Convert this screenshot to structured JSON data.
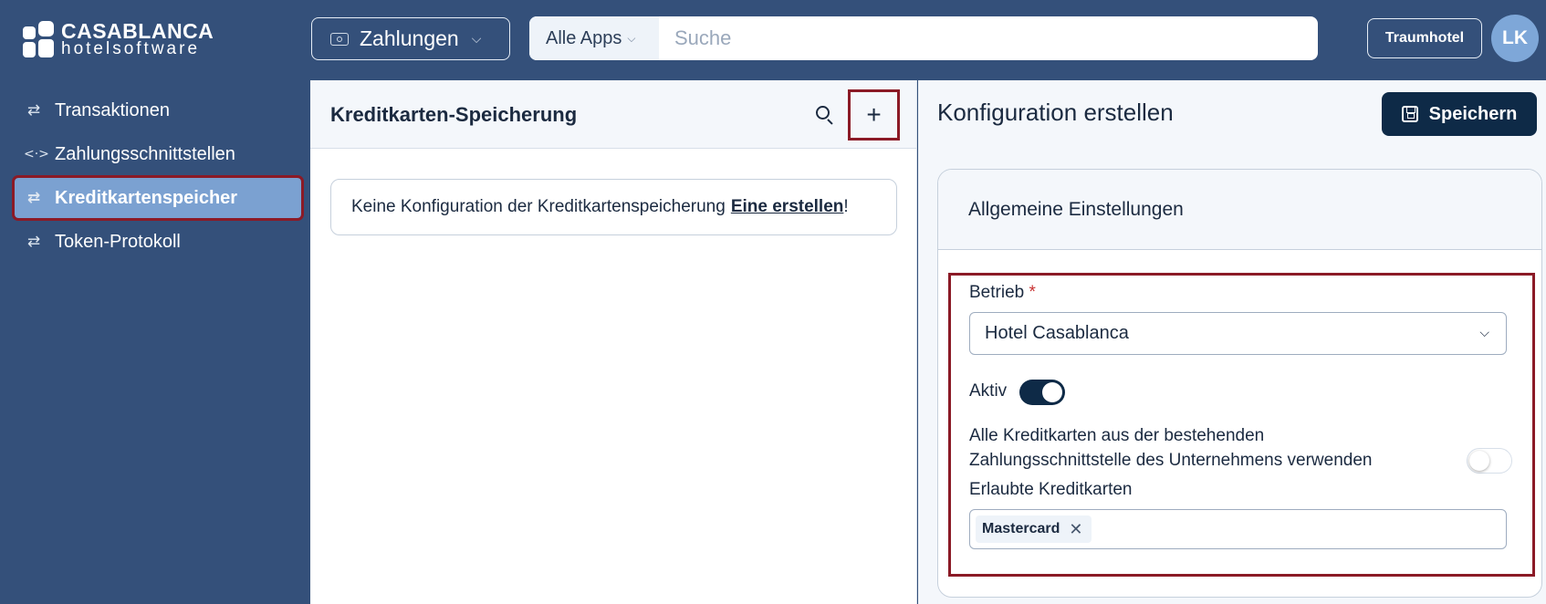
{
  "brand": {
    "line1": "CASABLANCA",
    "line2": "hotelsoftware"
  },
  "header": {
    "app_switcher_label": "Zahlungen",
    "app_switcher_icon": "wallet-icon",
    "search_scope": "Alle Apps",
    "search_placeholder": "Suche",
    "hotel_button": "Traumhotel",
    "avatar_initials": "LK"
  },
  "sidebar": {
    "items": [
      {
        "label": "Transaktionen",
        "icon": "arrows-swap-icon",
        "active": false
      },
      {
        "label": "Zahlungsschnittstellen",
        "icon": "code-brackets-icon",
        "active": false
      },
      {
        "label": "Kreditkartenspeicher",
        "icon": "arrows-swap-icon",
        "active": true
      },
      {
        "label": "Token-Protokoll",
        "icon": "arrows-swap-icon",
        "active": false
      }
    ]
  },
  "list_panel": {
    "title": "Kreditkarten-Speicherung",
    "empty_text": "Keine Konfiguration der Kreditkartenspeicherung",
    "empty_link": "Eine erstellen",
    "empty_suffix": "!"
  },
  "form_panel": {
    "title": "Konfiguration erstellen",
    "save_label": "Speichern",
    "section_title": "Allgemeine Einstellungen",
    "betrieb_label": "Betrieb",
    "required_mark": "*",
    "betrieb_value": "Hotel Casablanca",
    "aktiv_label": "Aktiv",
    "aktiv_value": true,
    "all_cards_label_line1": "Alle Kreditkarten aus der bestehenden",
    "all_cards_label_line2": "Zahlungsschnittstelle des Unternehmens verwenden",
    "all_cards_value": false,
    "allowed_cards_label": "Erlaubte Kreditkarten",
    "allowed_cards": [
      "Mastercard"
    ]
  },
  "colors": {
    "topbar": "#34507a",
    "active_item": "#7ba1d1",
    "highlight_border": "#8b1a26",
    "primary_button": "#0e2a47"
  }
}
